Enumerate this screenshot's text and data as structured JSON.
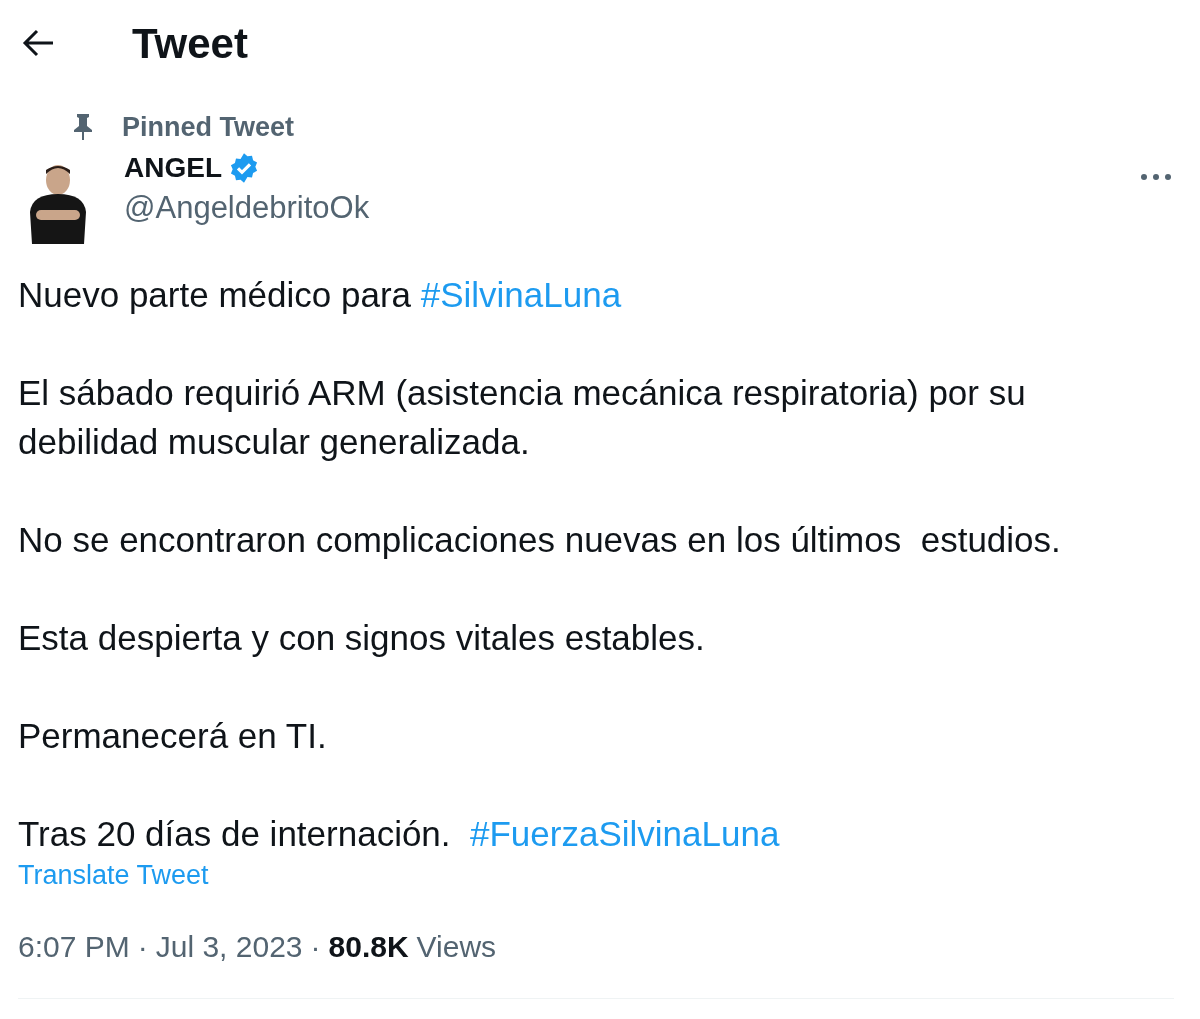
{
  "header": {
    "title": "Tweet"
  },
  "tweet": {
    "pinned_label": "Pinned Tweet",
    "author": {
      "name": "ANGEL",
      "verified": true,
      "handle": "@AngeldebritoOk"
    },
    "paragraphs": [
      [
        {
          "kind": "text",
          "text": "Nuevo parte médico para "
        },
        {
          "kind": "hashtag",
          "text": "#SilvinaLuna"
        }
      ],
      [
        {
          "kind": "text",
          "text": "El sábado requirió ARM (asistencia mecánica respiratoria) por su debilidad muscular generalizada."
        }
      ],
      [
        {
          "kind": "text",
          "text": "No se encontraron complicaciones nuevas en los últimos  estudios."
        }
      ],
      [
        {
          "kind": "text",
          "text": "Esta despierta y con signos vitales estables."
        }
      ],
      [
        {
          "kind": "text",
          "text": "Permanecerá en TI."
        }
      ],
      [
        {
          "kind": "text",
          "text": "Tras 20 días de internación.  "
        },
        {
          "kind": "hashtag",
          "text": "#FuerzaSilvinaLuna"
        }
      ]
    ],
    "translate_link": "Translate Tweet",
    "time": "6:07 PM",
    "date": "Jul 3, 2023",
    "views_count": "80.8K",
    "views_label": "Views",
    "separator": "·"
  }
}
